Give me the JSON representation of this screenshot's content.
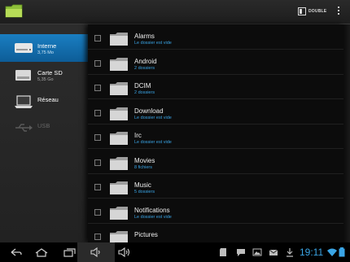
{
  "topbar": {
    "dual_label": "DOUBLE"
  },
  "sidebar": {
    "items": [
      {
        "title": "Interne",
        "subtitle": "3,75 Mo",
        "icon": "hard-drive-icon",
        "active": true
      },
      {
        "title": "Carte SD",
        "subtitle": "5,35 Go",
        "icon": "sd-card-icon",
        "active": false
      },
      {
        "title": "Réseau",
        "subtitle": "",
        "icon": "laptop-network-icon",
        "active": false
      },
      {
        "title": "USB",
        "subtitle": "",
        "icon": "usb-icon",
        "active": false,
        "disabled": true
      }
    ]
  },
  "files": [
    {
      "name": "Alarms",
      "detail": "Le dossier est vide"
    },
    {
      "name": "Android",
      "detail": "2 dossiers"
    },
    {
      "name": "DCIM",
      "detail": "2 dossiers"
    },
    {
      "name": "Download",
      "detail": "Le dossier est vide"
    },
    {
      "name": "Irc",
      "detail": "Le dossier est vide"
    },
    {
      "name": "Movies",
      "detail": "8 fichiers"
    },
    {
      "name": "Music",
      "detail": "5 dossiers"
    },
    {
      "name": "Notifications",
      "detail": "Le dossier est vide"
    },
    {
      "name": "Pictures",
      "detail": ""
    }
  ],
  "statusbar": {
    "clock": "19:11",
    "accent_color": "#3aa5e6",
    "buttons": [
      "back-icon",
      "home-icon",
      "recent-apps-icon",
      "volume-down-icon",
      "volume-up-icon"
    ],
    "tray_icons": [
      "sd-card-icon",
      "chat-icon",
      "image-icon",
      "mail-icon",
      "download-icon",
      "wifi-icon",
      "battery-icon"
    ]
  }
}
